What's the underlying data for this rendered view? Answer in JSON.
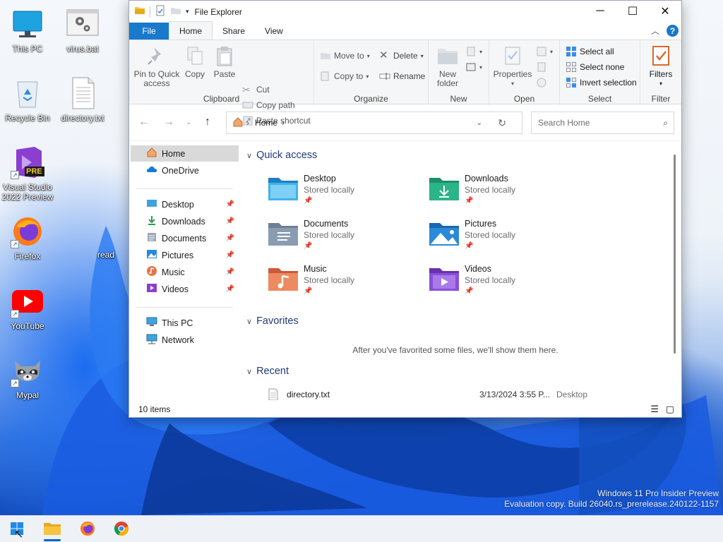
{
  "desktop": {
    "icons": [
      {
        "label": "This PC",
        "icon": "monitor-icon"
      },
      {
        "label": "virus.bat",
        "icon": "batch-gear-icon"
      },
      {
        "label": "Recycle Bin",
        "icon": "recycle-bin-icon"
      },
      {
        "label": "directory.txt",
        "icon": "text-file-icon"
      },
      {
        "label": "Visual Studio 2022 Preview",
        "icon": "visual-studio-icon"
      },
      {
        "label": "Firefox",
        "icon": "firefox-icon"
      },
      {
        "label": "YouTube",
        "icon": "youtube-icon"
      },
      {
        "label": "Mypal",
        "icon": "raccoon-icon"
      },
      {
        "label": "read",
        "icon": "partial-label"
      }
    ],
    "watermark_line1": "Windows 11 Pro Insider Preview",
    "watermark_line2": "Evaluation copy. Build 26040.rs_prerelease.240122-1157"
  },
  "window": {
    "title": "File Explorer",
    "tabs": [
      "File",
      "Home",
      "Share",
      "View"
    ],
    "active_tab": "Home"
  },
  "ribbon": {
    "clipboard": {
      "pin_label": "Pin to Quick access",
      "pin_line1": "Pin to Quick",
      "pin_line2": "access",
      "copy_label": "Copy",
      "paste_label": "Paste",
      "cut_label": "Cut",
      "copy_path_label": "Copy path",
      "paste_shortcut_label": "Paste shortcut",
      "group_label": "Clipboard"
    },
    "organize": {
      "move_to_label": "Move to",
      "copy_to_label": "Copy to",
      "delete_label": "Delete",
      "rename_label": "Rename",
      "group_label": "Organize"
    },
    "new": {
      "new_folder_line1": "New",
      "new_folder_line2": "folder",
      "group_label": "New"
    },
    "open": {
      "properties_label": "Properties",
      "group_label": "Open"
    },
    "select": {
      "select_all_label": "Select all",
      "select_none_label": "Select none",
      "invert_label": "Invert selection",
      "group_label": "Select"
    },
    "filter": {
      "filters_label": "Filters",
      "group_label": "Filter"
    }
  },
  "address": {
    "path": "Home",
    "search_placeholder": "Search Home"
  },
  "navpane": {
    "items": [
      {
        "label": "Home",
        "icon": "home-icon"
      },
      {
        "label": "OneDrive",
        "icon": "onedrive-icon"
      },
      {
        "label": "Desktop",
        "icon": "desktop-folder-icon",
        "pinned": true
      },
      {
        "label": "Downloads",
        "icon": "download-icon",
        "pinned": true
      },
      {
        "label": "Documents",
        "icon": "documents-icon",
        "pinned": true
      },
      {
        "label": "Pictures",
        "icon": "pictures-icon",
        "pinned": true
      },
      {
        "label": "Music",
        "icon": "music-icon",
        "pinned": true
      },
      {
        "label": "Videos",
        "icon": "videos-icon",
        "pinned": true
      },
      {
        "label": "This PC",
        "icon": "this-pc-icon"
      },
      {
        "label": "Network",
        "icon": "network-icon"
      }
    ]
  },
  "content": {
    "quick_access_title": "Quick access",
    "folders": [
      {
        "name": "Desktop",
        "status": "Stored locally"
      },
      {
        "name": "Downloads",
        "status": "Stored locally"
      },
      {
        "name": "Documents",
        "status": "Stored locally"
      },
      {
        "name": "Pictures",
        "status": "Stored locally"
      },
      {
        "name": "Music",
        "status": "Stored locally"
      },
      {
        "name": "Videos",
        "status": "Stored locally"
      }
    ],
    "favorites_title": "Favorites",
    "favorites_empty": "After you've favorited some files, we'll show them here.",
    "recent_title": "Recent",
    "recent": [
      {
        "name": "directory.txt",
        "date": "3/13/2024 3:55 P...",
        "location": "Desktop"
      }
    ]
  },
  "status": {
    "item_count": "10 items"
  },
  "taskbar": {
    "items": [
      "Start",
      "File Explorer",
      "Firefox",
      "Chrome"
    ]
  },
  "colors": {
    "accent": "#1979ca",
    "folder_yellow": "#f5c542"
  }
}
